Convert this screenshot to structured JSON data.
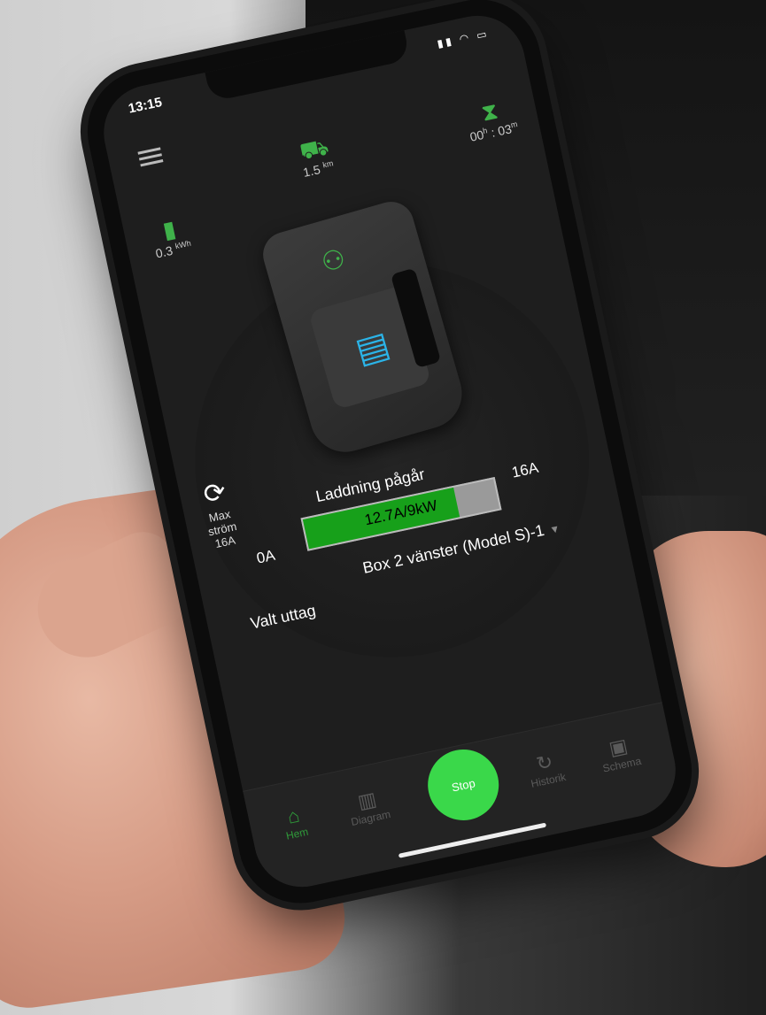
{
  "status_bar": {
    "time": "13:15",
    "icons": "▮▮ ◠ ▭"
  },
  "stats": {
    "energy": {
      "icon": "battery-icon",
      "value": "0.3",
      "unit": "kWh"
    },
    "range": {
      "icon": "car-range-icon",
      "value": "1.5",
      "unit": "km"
    },
    "time": {
      "icon": "hourglass-icon",
      "hours": "00",
      "hours_unit": "h",
      "minutes": "03",
      "minutes_unit": "m"
    }
  },
  "max_current": {
    "line1": "Max",
    "line2": "ström",
    "line3": "16A"
  },
  "charging": {
    "status": "Laddning pågår",
    "bar_text": "12.7A/9kW",
    "min_label": "0A",
    "max_label": "16A",
    "fill_fraction": 0.79
  },
  "outlet": {
    "label": "Valt uttag",
    "selected": "Box 2 vänster (Model S)-1"
  },
  "tabs": {
    "home": "Hem",
    "diagram": "Diagram",
    "stop": "Stop",
    "history": "Historik",
    "schedule": "Schema"
  },
  "colors": {
    "accent_green": "#3fb24a",
    "stop_button": "#3ad84a",
    "bar_fill": "#17a01a",
    "battery_blue": "#2bb4e8"
  }
}
